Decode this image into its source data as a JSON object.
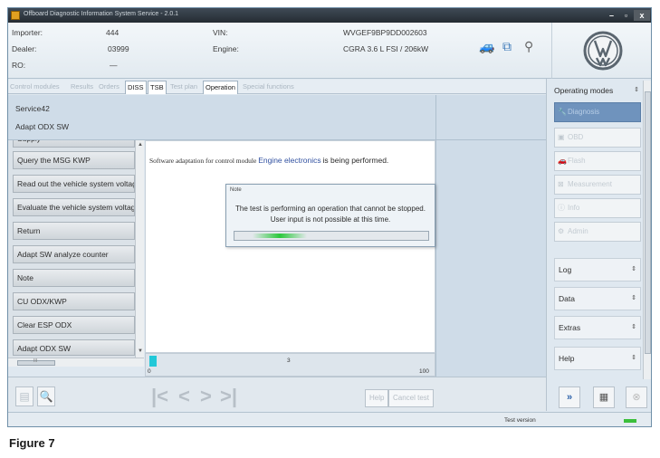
{
  "window": {
    "title": "Offboard Diagnostic Information System Service - 2.0.1",
    "controls": {
      "minimize": "–",
      "maximize": "▫",
      "close": "x"
    }
  },
  "vehicle_info": {
    "importer_label": "Importer:",
    "importer_value": "444",
    "dealer_label": "Dealer:",
    "dealer_value": "03999",
    "ro_label": "RO:",
    "ro_value": "—",
    "vin_label": "VIN:",
    "vin_value": "WVGEF9BP9DD002603",
    "engine_label": "Engine:",
    "engine_value": "CGRA 3.6 L FSI / 206kW"
  },
  "tabs": [
    {
      "label": "Control modules",
      "active": false
    },
    {
      "label": "Results",
      "active": false
    },
    {
      "label": "Orders",
      "active": false
    },
    {
      "label": "DISS",
      "active": true
    },
    {
      "label": "TSB",
      "active": true
    },
    {
      "label": "Test plan",
      "active": false
    },
    {
      "label": "Operation",
      "active": true
    },
    {
      "label": "Special functions",
      "active": false
    }
  ],
  "service": {
    "line1": "Service42",
    "line2": "Adapt ODX SW"
  },
  "left_list": {
    "partial_item": "Supply",
    "items": [
      "Query the MSG KWP",
      "Read out the vehicle system voltage",
      "Evaluate the vehicle system voltage",
      "Return",
      "Adapt SW analyze counter",
      "Note",
      "CU ODX/KWP",
      "Clear ESP ODX",
      "Adapt ODX SW"
    ],
    "hscroll_label": "III"
  },
  "work_area": {
    "message_prefix": "Software adaptation for control module",
    "message_module": "Engine electronics",
    "message_suffix": "is being performed."
  },
  "dialog": {
    "title": "Note",
    "line1": "The test is performing an operation that cannot be stopped.",
    "line2": "User input is not possible at this time.",
    "progress_color": "#2ac83c"
  },
  "progress_strip": {
    "current": "3",
    "start": "0",
    "end": "100"
  },
  "toolbar": {
    "help_label": "Help",
    "cancel_label": "Cancel test"
  },
  "right_panel": {
    "operating_modes_label": "Operating modes",
    "modes": [
      {
        "label": "Diagnosis",
        "icon": "wrench-icon",
        "selected": true
      },
      {
        "label": "OBD",
        "icon": "obd-icon",
        "selected": false
      },
      {
        "label": "Flash",
        "icon": "car-icon",
        "selected": false
      },
      {
        "label": "Measurement",
        "icon": "meter-icon",
        "selected": false
      },
      {
        "label": "Info",
        "icon": "info-icon",
        "selected": false
      },
      {
        "label": "Admin",
        "icon": "admin-icon",
        "selected": false
      }
    ],
    "sections": [
      "Log",
      "Data",
      "Extras",
      "Help"
    ]
  },
  "status_bar": {
    "text": "Test version"
  },
  "caption": "Figure 7",
  "colors": {
    "accent_selected": "#6f93bd",
    "title_bar": "#2b333b",
    "progress": "#2ac83c"
  }
}
